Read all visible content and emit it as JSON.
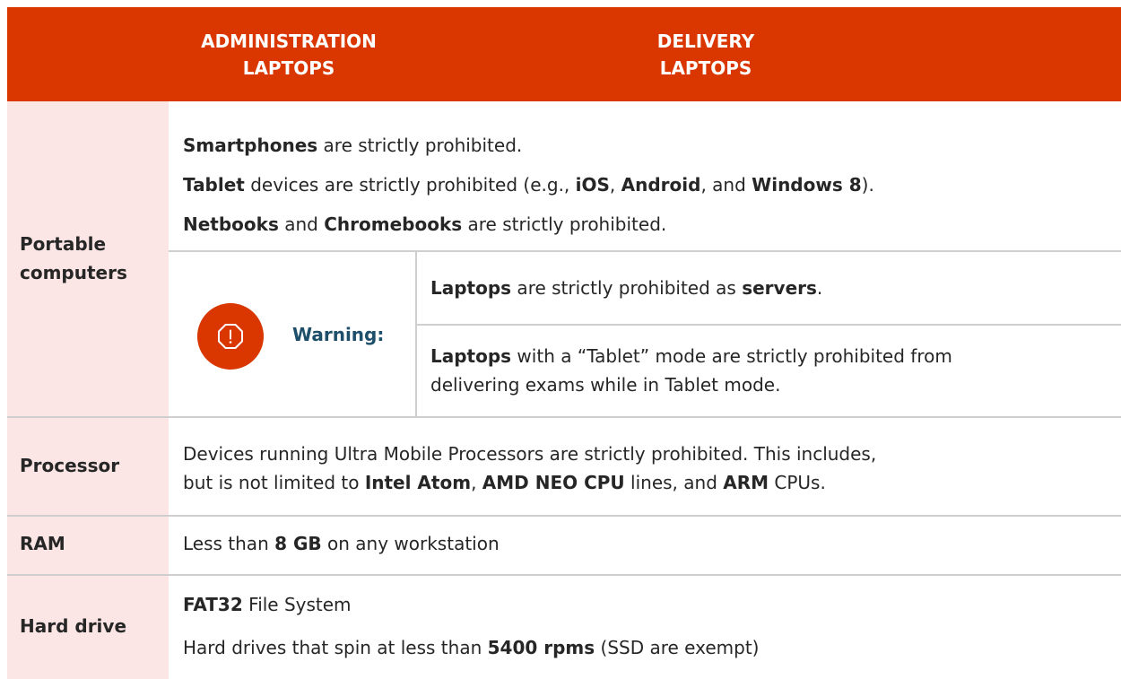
{
  "header": {
    "col1_line1": "ADMINISTRATION",
    "col1_line2": "LAPTOPS",
    "col2_line1": "DELIVERY",
    "col2_line2": "LAPTOPS"
  },
  "rows": {
    "portable": {
      "label_line1": "Portable",
      "label_line2": "computers",
      "p1_b1": "Smartphones",
      "p1_t1": " are strictly prohibited.",
      "p2_b1": "Tablet",
      "p2_t1": " devices are strictly prohibited (e.g., ",
      "p2_b2": "iOS",
      "p2_t2": ", ",
      "p2_b3": "Android",
      "p2_t3": ", and ",
      "p2_b4": "Windows 8",
      "p2_t4": ").",
      "p3_b1": "Netbooks",
      "p3_t1": " and ",
      "p3_b2": "Chromebooks",
      "p3_t2": " are strictly prohibited.",
      "warning_label": "Warning:",
      "w1_b1": "Laptops",
      "w1_t1": " are strictly prohibited as ",
      "w1_b2": "servers",
      "w1_t2": ".",
      "w2_b1": "Laptops",
      "w2_t1": " with a “Tablet” mode are strictly prohibited from",
      "w2_t2": "delivering exams while in Tablet mode."
    },
    "processor": {
      "label": "Processor",
      "l1": "Devices running Ultra Mobile Processors are strictly prohibited. This includes,",
      "l2_t1": "but is not limited to ",
      "l2_b1": "Intel Atom",
      "l2_t2": ", ",
      "l2_b2": "AMD NEO CPU",
      "l2_t3": " lines, and ",
      "l2_b3": "ARM",
      "l2_t4": " CPUs."
    },
    "ram": {
      "label": "RAM",
      "t1": "Less than ",
      "b1": "8 GB",
      "t2": " on any workstation"
    },
    "harddrive": {
      "label": "Hard drive",
      "p1_b1": "FAT32",
      "p1_t1": " File System",
      "p2_t1": "Hard drives that spin at less than ",
      "p2_b1": "5400 rpms",
      "p2_t2": " (SSD are exempt)"
    }
  },
  "colors": {
    "header_bg": "#d93600",
    "label_bg": "#fbe5e5",
    "warning_text": "#1d4f6b",
    "warning_icon_bg": "#d93600"
  },
  "icons": {
    "warning": "octagon-exclamation-icon"
  }
}
